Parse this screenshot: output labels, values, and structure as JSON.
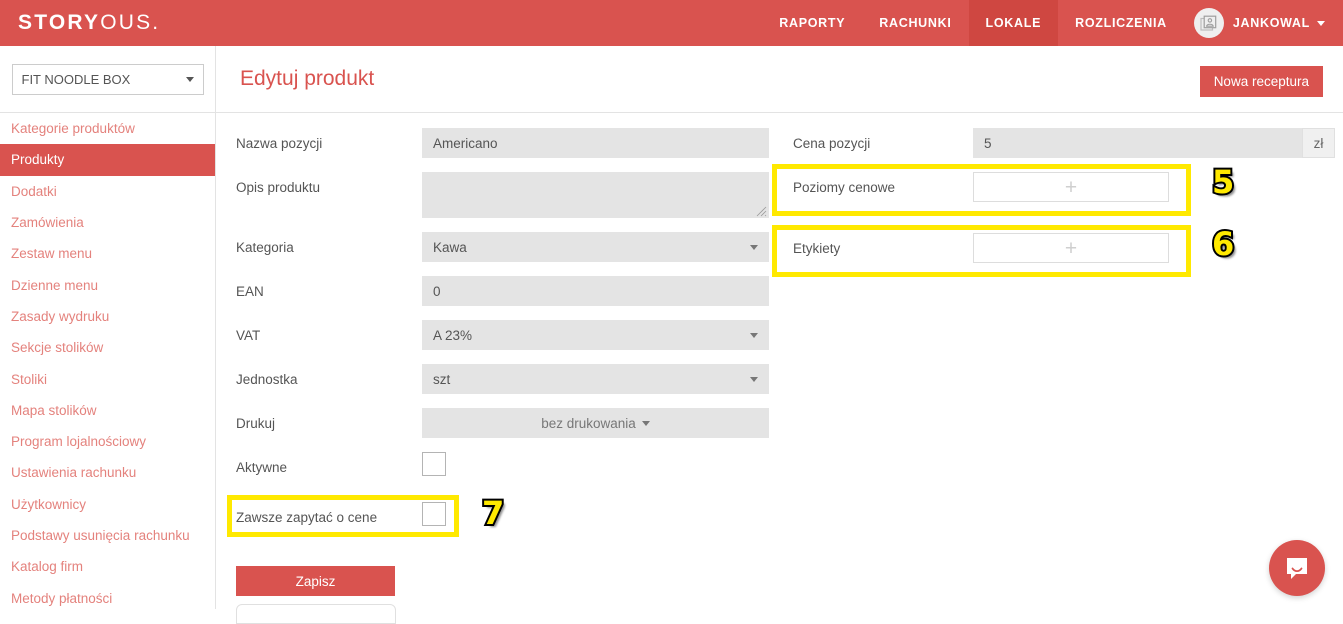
{
  "navbar": {
    "brand_bold": "STORY",
    "brand_light": "OUS.",
    "items": [
      {
        "label": "RAPORTY",
        "active": false
      },
      {
        "label": "RACHUNKI",
        "active": false
      },
      {
        "label": "LOKALE",
        "active": true
      },
      {
        "label": "ROZLICZENIA",
        "active": false
      }
    ],
    "user": "JANKOWAL",
    "avatar_icon": "user-portrait-icon",
    "caret_icon": "chevron-down-icon",
    "bg_color": "#d9534f",
    "active_bg_color": "#cf4741"
  },
  "subheader": {
    "location_select": "FIT NOODLE BOX",
    "location_caret_icon": "chevron-down-icon",
    "page_title": "Edytuj produkt",
    "new_recipe_button": "Nowa receptura"
  },
  "sidebar": {
    "items": [
      {
        "label": "Kategorie produktów",
        "active": false
      },
      {
        "label": "Produkty",
        "active": true
      },
      {
        "label": "Dodatki",
        "active": false
      },
      {
        "label": "Zamówienia",
        "active": false
      },
      {
        "label": "Zestaw menu",
        "active": false
      },
      {
        "label": "Dzienne menu",
        "active": false
      },
      {
        "label": "Zasady wydruku",
        "active": false
      },
      {
        "label": "Sekcje stolików",
        "active": false
      },
      {
        "label": "Stoliki",
        "active": false
      },
      {
        "label": "Mapa stolików",
        "active": false
      },
      {
        "label": "Program lojalnościowy",
        "active": false
      },
      {
        "label": "Ustawienia rachunku",
        "active": false
      },
      {
        "label": "Użytkownicy",
        "active": false
      },
      {
        "label": "Podstawy usunięcia rachunku",
        "active": false
      },
      {
        "label": "Katalog firm",
        "active": false
      },
      {
        "label": "Metody płatności",
        "active": false
      }
    ]
  },
  "form": {
    "name": {
      "label": "Nazwa pozycji",
      "value": "Americano"
    },
    "description": {
      "label": "Opis produktu",
      "value": ""
    },
    "category": {
      "label": "Kategoria",
      "value": "Kawa",
      "caret_icon": "chevron-down-icon"
    },
    "ean": {
      "label": "EAN",
      "value": "0"
    },
    "vat": {
      "label": "VAT",
      "value": "A 23%",
      "caret_icon": "chevron-down-icon"
    },
    "unit": {
      "label": "Jednostka",
      "value": "szt",
      "caret_icon": "chevron-down-icon"
    },
    "print": {
      "label": "Drukuj",
      "value": "bez drukowania",
      "caret_icon": "caret-down-icon"
    },
    "active": {
      "label": "Aktywne",
      "checked": false
    },
    "always_ask_price": {
      "label": "Zawsze zapytać o cene",
      "checked": false
    },
    "save_button": "Zapisz",
    "price": {
      "label": "Cena pozycji",
      "value": "5",
      "currency": "zł"
    },
    "price_levels": {
      "label": "Poziomy cenowe",
      "add_icon": "plus-icon",
      "add_label": "+"
    },
    "labels_field": {
      "label": "Etykiety",
      "add_icon": "plus-icon",
      "add_label": "+"
    }
  },
  "annotations": {
    "badge_5": "5",
    "badge_6": "6",
    "badge_7": "7",
    "highlight_color": "#ffe900"
  },
  "chat": {
    "icon": "chat-bubble-icon",
    "color": "#d9534f"
  }
}
